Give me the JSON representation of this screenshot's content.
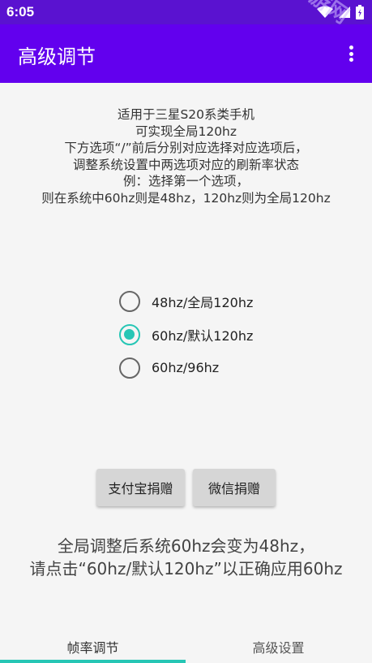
{
  "status_bar": {
    "time": "6:05",
    "icons": [
      "wifi-icon",
      "signal-icon",
      "battery-icon"
    ]
  },
  "app_bar": {
    "title": "高级调节",
    "menu_icon": "more-vert-icon"
  },
  "watermark": {
    "text": "新华手游网"
  },
  "description": {
    "lines": [
      "适用于三星S20系类手机",
      "可实现全局120hz",
      "下方选项“/”前后分别对应选择对应选项后，",
      "调整系统设置中两选项对应的刷新率状态",
      "例：选择第一个选项，",
      "则在系统中60hz则是48hz，120hz则为全局120hz"
    ]
  },
  "refresh_options": {
    "selected_index": 1,
    "options": [
      {
        "label": "48hz/全局120hz",
        "checked": false
      },
      {
        "label": "60hz/默认120hz",
        "checked": true
      },
      {
        "label": "60hz/96hz",
        "checked": false
      }
    ]
  },
  "donate": {
    "alipay_label": "支付宝捐赠",
    "wechat_label": "微信捐赠"
  },
  "notice": {
    "lines": [
      "全局调整后系统60hz会变为48hz，",
      "请点击“60hz/默认120hz”以正确应用60hz"
    ]
  },
  "tabs": [
    {
      "label": "帧率调节",
      "active": true
    },
    {
      "label": "高级设置",
      "active": false
    }
  ],
  "colors": {
    "status_bar": "#5a12d0",
    "app_bar": "#6200ee",
    "accent": "#26c6b5",
    "background": "#f5f5f5",
    "button": "#d6d6d6"
  }
}
